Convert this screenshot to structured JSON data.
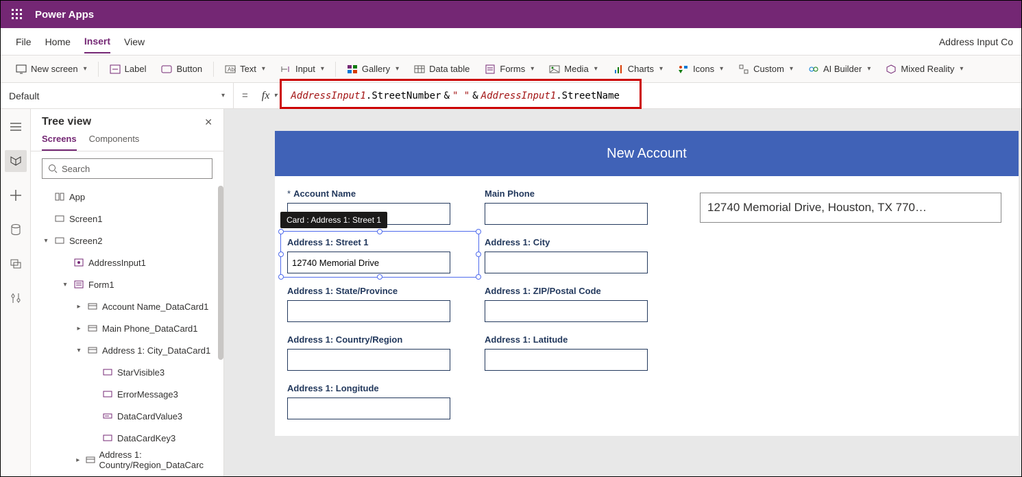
{
  "app": {
    "name": "Power Apps"
  },
  "breadcrumb": "Address Input Co",
  "menus": {
    "file": "File",
    "home": "Home",
    "insert": "Insert",
    "view": "View"
  },
  "ribbon": {
    "newScreen": "New screen",
    "label": "Label",
    "button": "Button",
    "text": "Text",
    "input": "Input",
    "gallery": "Gallery",
    "dataTable": "Data table",
    "forms": "Forms",
    "media": "Media",
    "charts": "Charts",
    "icons": "Icons",
    "custom": "Custom",
    "aiBuilder": "AI Builder",
    "mixedReality": "Mixed Reality"
  },
  "formula": {
    "property": "Default",
    "obj1": "AddressInput1",
    "prop1": ".StreetNumber",
    "op1": " & ",
    "str": "\" \"",
    "op2": " & ",
    "obj2": "AddressInput1",
    "prop2": ".StreetName"
  },
  "tree": {
    "title": "Tree view",
    "tabs": {
      "screens": "Screens",
      "components": "Components"
    },
    "searchPlaceholder": "Search",
    "nodes": {
      "app": "App",
      "screen1": "Screen1",
      "screen2": "Screen2",
      "addressInput1": "AddressInput1",
      "form1": "Form1",
      "accountName": "Account Name_DataCard1",
      "mainPhone": "Main Phone_DataCard1",
      "addressCity": "Address 1: City_DataCard1",
      "starVisible": "StarVisible3",
      "errorMessage": "ErrorMessage3",
      "dataCardValue": "DataCardValue3",
      "dataCardKey": "DataCardKey3",
      "addressCountry": "Address 1: Country/Region_DataCarc"
    }
  },
  "canvas": {
    "header": "New Account",
    "tooltip": "Card : Address 1: Street 1",
    "cards": {
      "accountName": "Account Name",
      "mainPhone": "Main Phone",
      "street1": "Address 1: Street 1",
      "street1Value": "12740 Memorial Drive",
      "city": "Address 1: City",
      "state": "Address 1: State/Province",
      "zip": "Address 1: ZIP/Postal Code",
      "country": "Address 1: Country/Region",
      "latitude": "Address 1: Latitude",
      "longitude": "Address 1: Longitude"
    },
    "bigInput": "12740 Memorial Drive, Houston, TX 770…"
  }
}
